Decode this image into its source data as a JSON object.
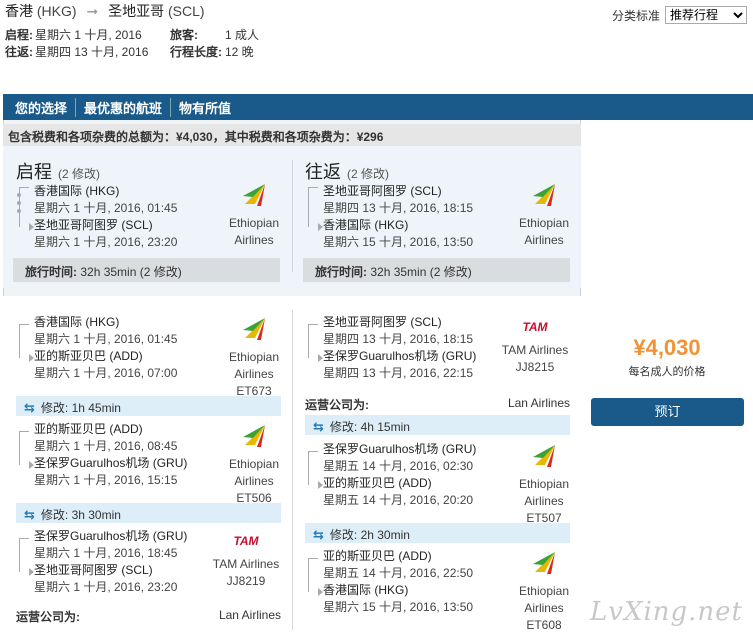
{
  "route": {
    "origin": "香港",
    "origin_code": "(HKG)",
    "dest": "圣地亚哥",
    "dest_code": "(SCL)"
  },
  "trip": {
    "depart_label": "启程:",
    "depart_value": "星期六 1 十月, 2016",
    "return_label": "往返:",
    "return_value": "星期四 13 十月, 2016",
    "passengers_label": "旅客:",
    "passengers_value": "1 成人",
    "length_label": "行程长度:",
    "length_value": "12 晚"
  },
  "sort": {
    "label": "分类标准",
    "selected": "推荐行程"
  },
  "tabs": [
    "您的选择",
    "最优惠的航班",
    "物有所值"
  ],
  "total": "包含税费和各项杂费的总额为：¥4,030，其中税费和各项杂费为：¥296",
  "outbound": {
    "title": "启程",
    "changes": "(2 修改)",
    "from": "香港国际 (HKG)",
    "from_time": "星期六 1 十月, 2016, 01:45",
    "to": "圣地亚哥阿图罗 (SCL)",
    "to_time": "星期六 1 十月, 2016, 23:20",
    "airline_1": "Ethiopian",
    "airline_2": "Airlines",
    "duration_label": "旅行时间:",
    "duration": "32h 35min (2 修改)"
  },
  "inbound": {
    "title": "往返",
    "changes": "(2 修改)",
    "from": "圣地亚哥阿图罗 (SCL)",
    "from_time": "星期四 13 十月, 2016, 18:15",
    "to": "香港国际 (HKG)",
    "to_time": "星期六 15 十月, 2016, 13:50",
    "airline_1": "Ethiopian",
    "airline_2": "Airlines",
    "duration_label": "旅行时间:",
    "duration": "32h 35min (2 修改)"
  },
  "out_segments": [
    {
      "from": "香港国际 (HKG)",
      "from_time": "星期六 1 十月, 2016, 01:45",
      "to": "亚的斯亚贝巴 (ADD)",
      "to_time": "星期六 1 十月, 2016, 07:00",
      "airline_1": "Ethiopian",
      "airline_2": "Airlines",
      "flight": "ET673"
    },
    {
      "from": "亚的斯亚贝巴 (ADD)",
      "from_time": "星期六 1 十月, 2016, 08:45",
      "to": "圣保罗Guarulhos机场 (GRU)",
      "to_time": "星期六 1 十月, 2016, 15:15",
      "airline_1": "Ethiopian",
      "airline_2": "Airlines",
      "flight": "ET506"
    },
    {
      "from": "圣保罗Guarulhos机场 (GRU)",
      "from_time": "星期六 1 十月, 2016, 18:45",
      "to": "圣地亚哥阿图罗 (SCL)",
      "to_time": "星期六 1 十月, 2016, 23:20",
      "airline_1": "TAM Airlines",
      "flight": "JJ8219"
    }
  ],
  "out_layovers": [
    "修改: 1h 45min",
    "修改: 3h 30min"
  ],
  "out_operated": {
    "label": "运营公司为:",
    "value": "Lan Airlines"
  },
  "in_segments": [
    {
      "from": "圣地亚哥阿图罗 (SCL)",
      "from_time": "星期四 13 十月, 2016, 18:15",
      "to": "圣保罗Guarulhos机场 (GRU)",
      "to_time": "星期四 13 十月, 2016, 22:15",
      "airline_1": "TAM Airlines",
      "flight": "JJ8215"
    },
    {
      "from": "圣保罗Guarulhos机场 (GRU)",
      "from_time": "星期五 14 十月, 2016, 02:30",
      "to": "亚的斯亚贝巴 (ADD)",
      "to_time": "星期五 14 十月, 2016, 20:20",
      "airline_1": "Ethiopian",
      "airline_2": "Airlines",
      "flight": "ET507"
    },
    {
      "from": "亚的斯亚贝巴 (ADD)",
      "from_time": "星期五 14 十月, 2016, 22:50",
      "to": "香港国际 (HKG)",
      "to_time": "星期六 15 十月, 2016, 13:50",
      "airline_1": "Ethiopian",
      "airline_2": "Airlines",
      "flight": "ET608"
    }
  ],
  "in_layovers": [
    "修改: 4h 15min",
    "修改: 2h 30min"
  ],
  "in_operated": {
    "label": "运营公司为:",
    "value": "Lan Airlines"
  },
  "price": {
    "amount": "¥4,030",
    "sub": "每名成人的价格"
  },
  "book_label": "预订",
  "watermark": "LvXing.net",
  "icons": {
    "ethiopian": "ethiopian-logo-icon",
    "tam": "tam-logo-icon",
    "layover": "swap-arrows-icon",
    "route": "right-arrow-icon"
  },
  "colors": {
    "nav": "#1a5a8a",
    "price": "#f39234",
    "layover_bg": "#ddeef9"
  }
}
